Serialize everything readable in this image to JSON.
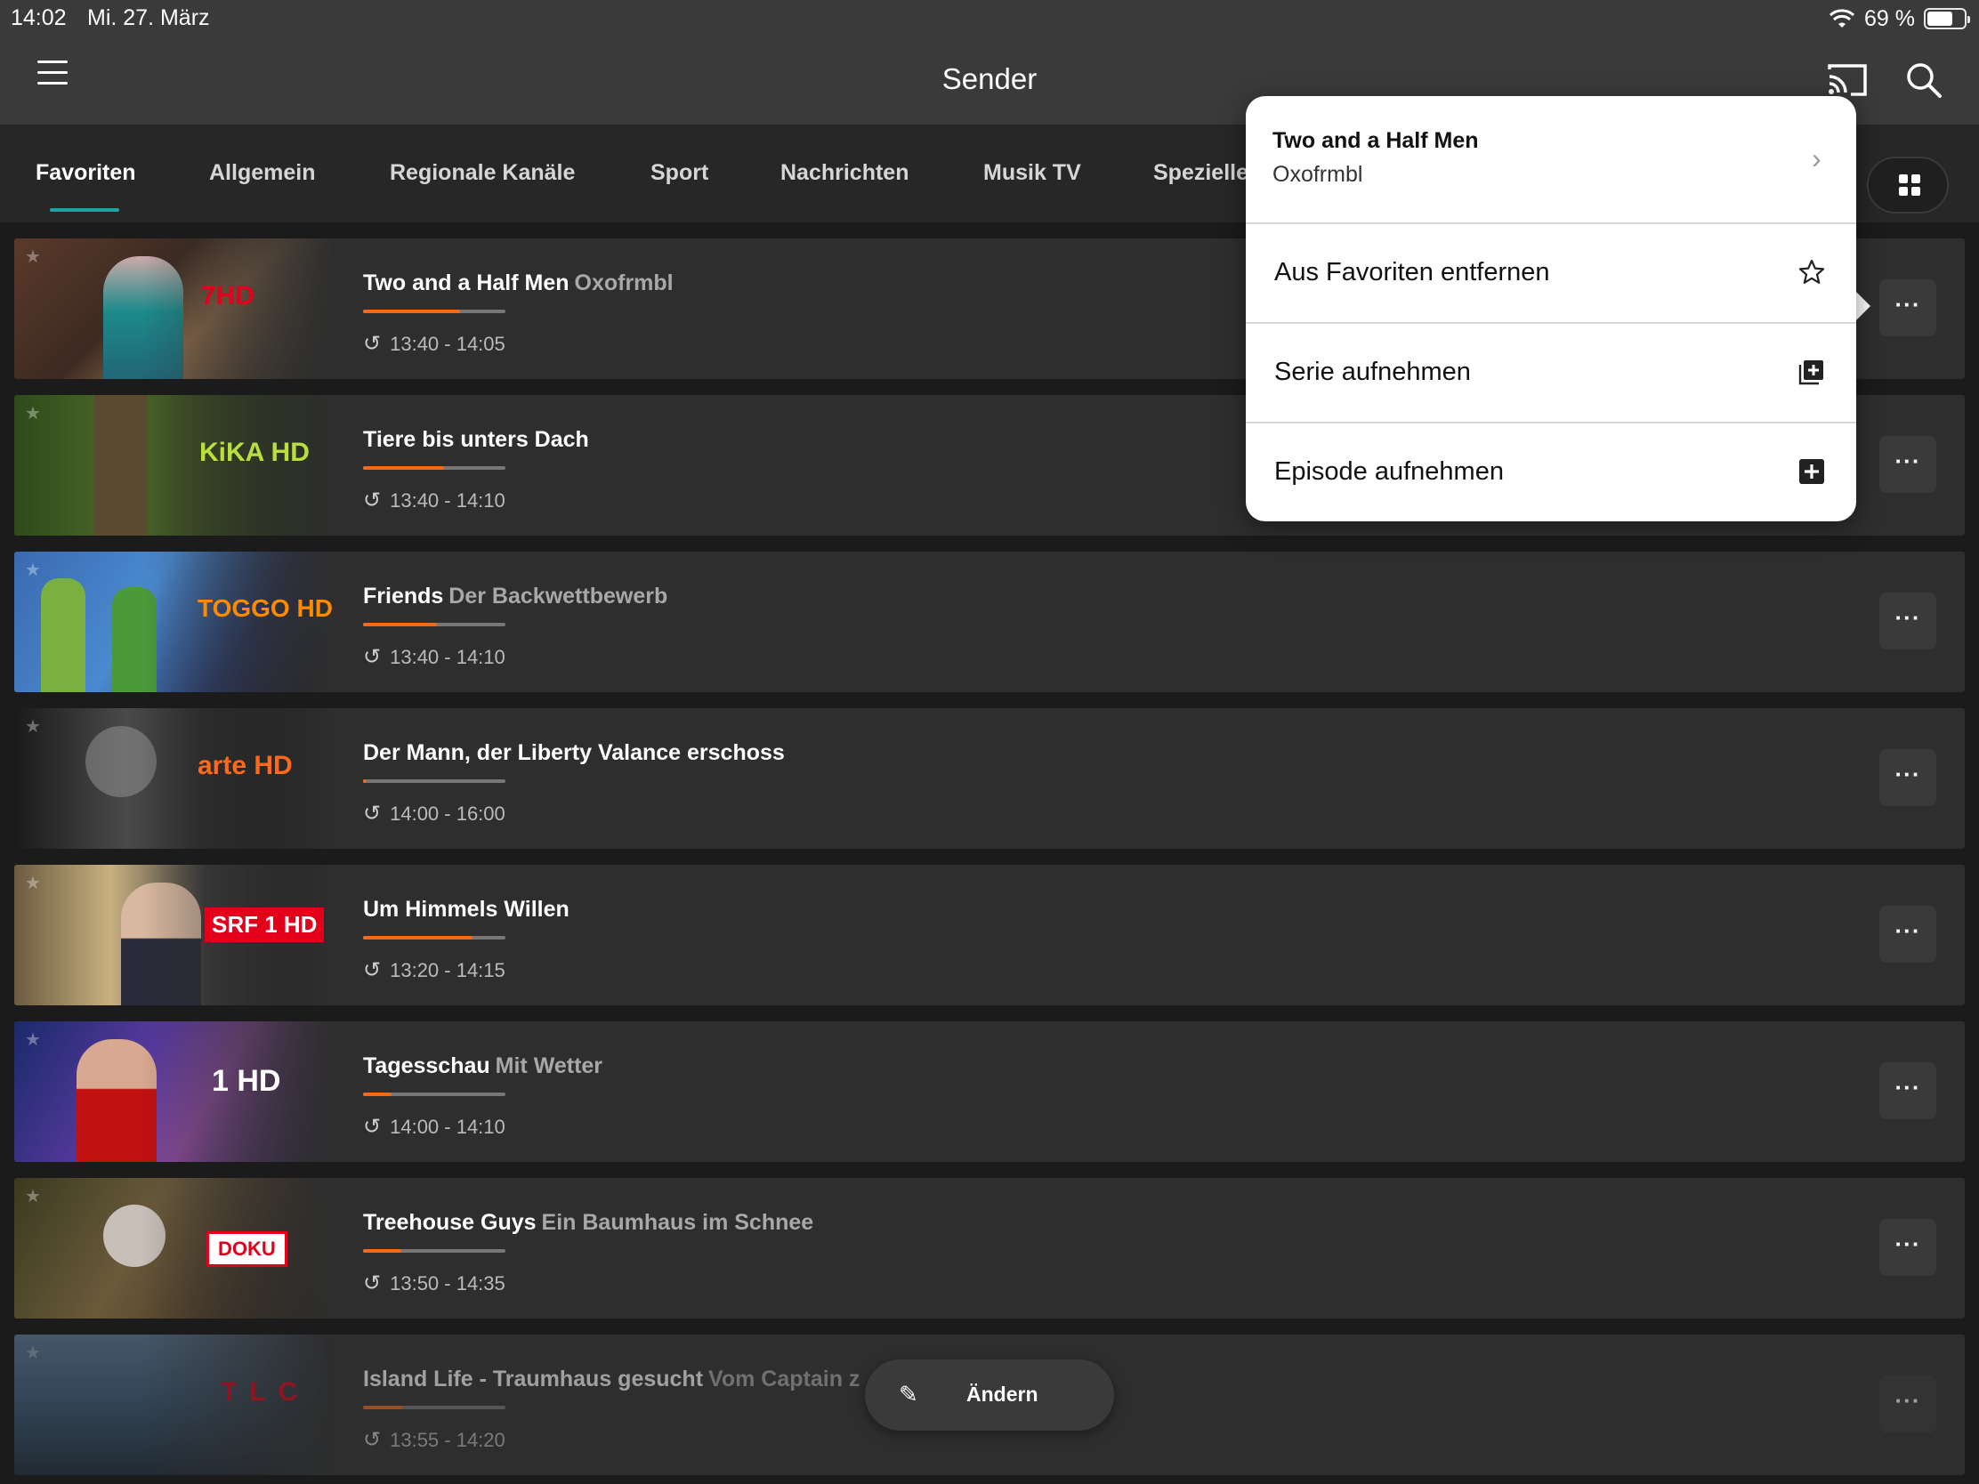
{
  "status_bar": {
    "time": "14:02",
    "date": "Mi. 27. März",
    "battery": "69 %",
    "battery_level": 0.69,
    "wifi_icon": "wifi-icon"
  },
  "nav": {
    "title": "Sender",
    "menu_icon": "hamburger-menu-icon",
    "cast_icon": "cast-icon",
    "search_icon": "search-icon"
  },
  "tabs": [
    {
      "label": "Favoriten",
      "active": true
    },
    {
      "label": "Allgemein",
      "active": false
    },
    {
      "label": "Regionale Kanäle",
      "active": false
    },
    {
      "label": "Sport",
      "active": false
    },
    {
      "label": "Nachrichten",
      "active": false
    },
    {
      "label": "Musik TV",
      "active": false
    },
    {
      "label": "Spezielle",
      "active": false
    }
  ],
  "channels": [
    {
      "logo": "7HD",
      "title": "Two and a Half Men",
      "subtitle": "Oxofrmbl",
      "time": "13:40 - 14:05",
      "progress": 0.68
    },
    {
      "logo": "KiKA HD",
      "title": "Tiere bis unters Dach",
      "subtitle": "",
      "time": "13:40 - 14:10",
      "progress": 0.57
    },
    {
      "logo": "TOGGO HD",
      "title": "Friends",
      "subtitle": "Der Backwettbewerb",
      "time": "13:40 - 14:10",
      "progress": 0.52
    },
    {
      "logo": "arte HD",
      "title": "Der Mann, der Liberty Valance erschoss",
      "subtitle": "",
      "time": "14:00 - 16:00",
      "progress": 0.02
    },
    {
      "logo": "SRF 1 HD",
      "title": "Um Himmels Willen",
      "subtitle": "",
      "time": "13:20 - 14:15",
      "progress": 0.77
    },
    {
      "logo": "1 HD",
      "title": "Tagesschau",
      "subtitle": "Mit Wetter",
      "time": "14:00 - 14:10",
      "progress": 0.2
    },
    {
      "logo": "DOKU",
      "title": "Treehouse Guys",
      "subtitle": "Ein Baumhaus im Schnee",
      "time": "13:50 - 14:35",
      "progress": 0.27
    },
    {
      "logo": "TLC",
      "title": "Island Life - Traumhaus gesucht",
      "subtitle": "Vom Captain z",
      "time": "13:55 - 14:20",
      "progress": 0.28
    }
  ],
  "popover": {
    "title": "Two and a Half Men",
    "subtitle": "Oxofrmbl",
    "items": [
      {
        "label": "Aus Favoriten entfernen",
        "icon": "star-outline-icon"
      },
      {
        "label": "Serie aufnehmen",
        "icon": "record-series-icon"
      },
      {
        "label": "Episode aufnehmen",
        "icon": "record-episode-icon"
      }
    ]
  },
  "edit_button": {
    "label": "Ändern",
    "icon": "pencil-icon"
  },
  "colors": {
    "accent_teal": "#1fa3a3",
    "progress_orange": "#f06a1a",
    "background": "#1b1b1b",
    "row_background": "#2e2e2e"
  }
}
